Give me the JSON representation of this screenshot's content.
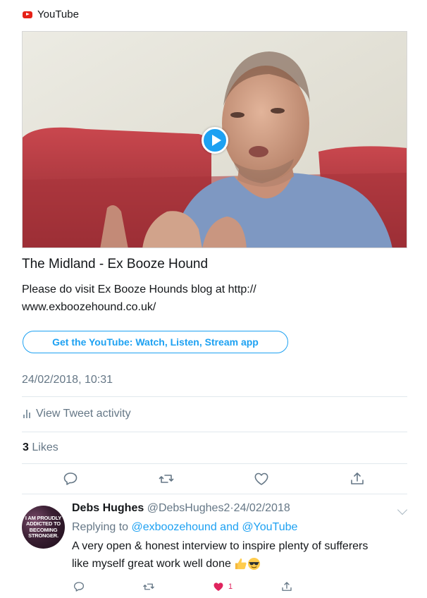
{
  "source": {
    "name": "YouTube"
  },
  "card": {
    "title": "The Midland - Ex Booze Hound",
    "description": "Please do visit Ex Booze Hounds blog at http:// www.exboozehound.co.uk/",
    "app_button": "Get the YouTube: Watch, Listen, Stream app"
  },
  "tweet": {
    "timestamp": "24/02/2018, 10:31",
    "activity_label": "View Tweet activity",
    "likes_count": "3",
    "likes_label": "Likes"
  },
  "reply": {
    "avatar_text": "I AM PROUDLY ADDICTED TO BECOMING STRONGER.",
    "name": "Debs Hughes",
    "handle": "@DebsHughes2",
    "separator": "·",
    "date": "24/02/2018",
    "replying_prefix": "Replying to",
    "replying_to": "@exboozehound and @YouTube",
    "text": "A very open & honest interview to inspire plenty of sufferers like myself great work well done",
    "like_count": "1"
  },
  "colors": {
    "accent": "#1da1f2",
    "muted": "#657786",
    "like": "#e0245e",
    "youtube": "#e62117"
  },
  "icons": {
    "actions": [
      "reply-icon",
      "retweet-icon",
      "like-icon",
      "share-icon"
    ]
  }
}
